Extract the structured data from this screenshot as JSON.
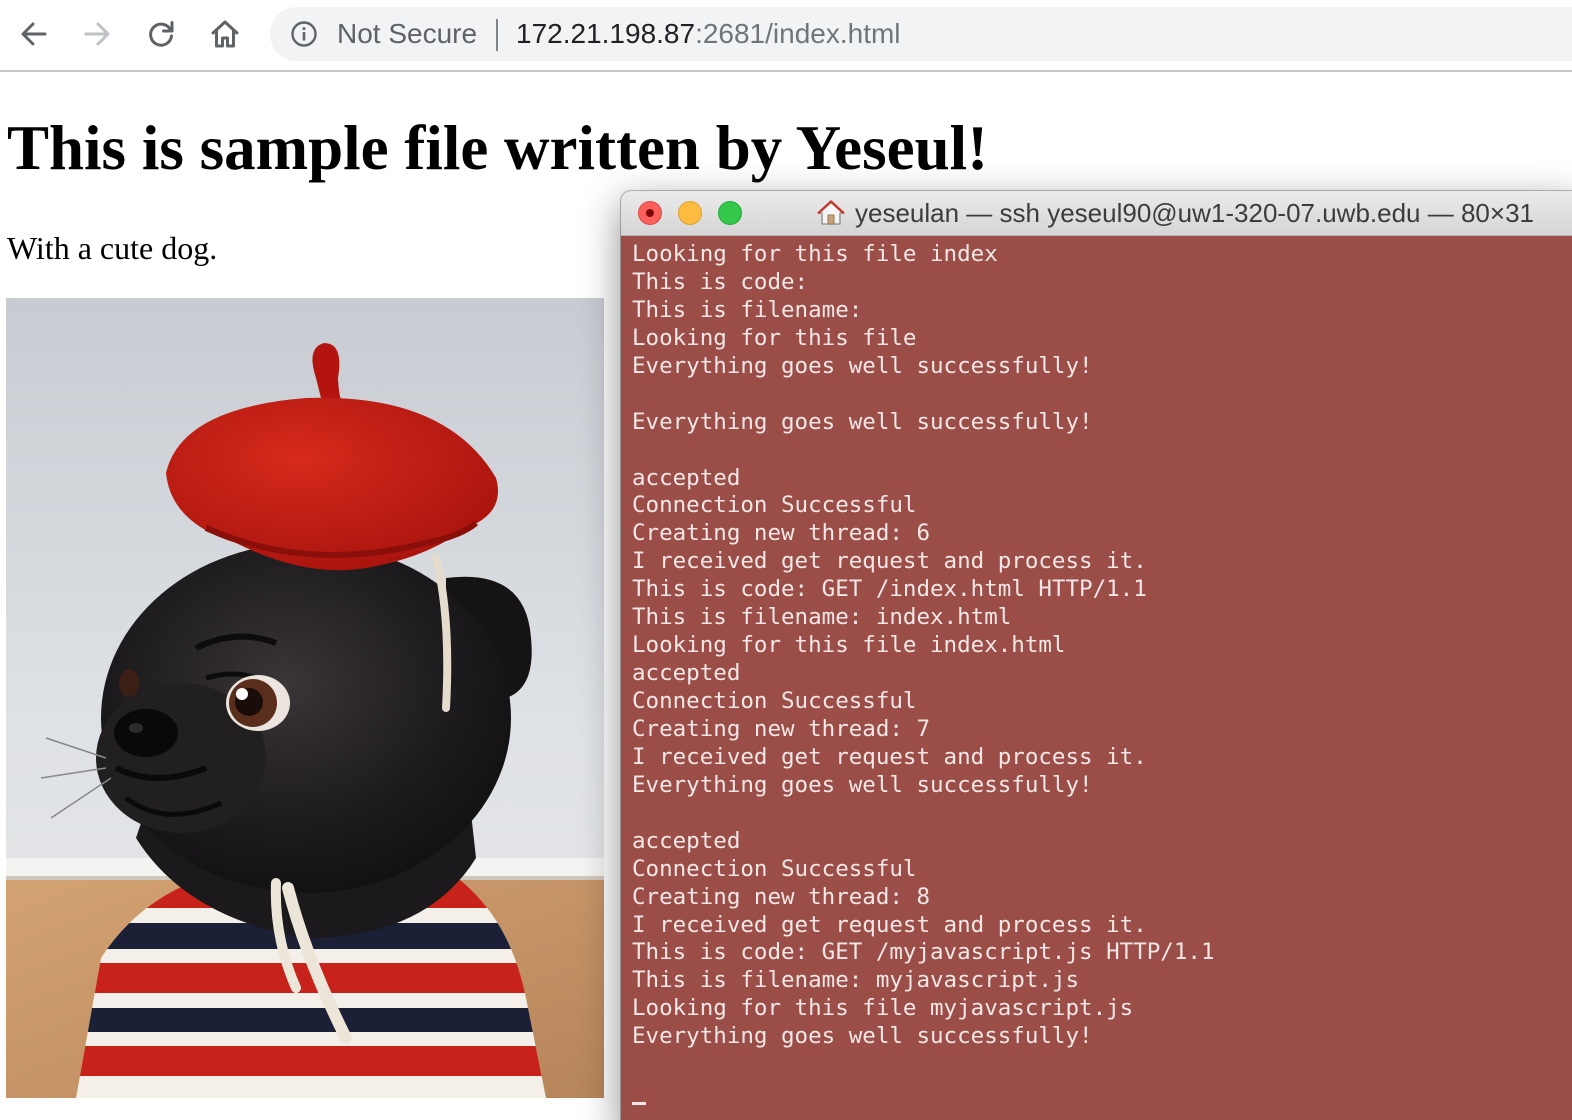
{
  "browser": {
    "security_label": "Not Secure",
    "url_host": "172.21.198.87",
    "url_rest": ":2681/index.html",
    "icons": {
      "back": "arrow-left-icon",
      "forward": "arrow-right-icon",
      "reload": "reload-icon",
      "home": "home-icon",
      "info": "info-circle-icon"
    }
  },
  "page": {
    "heading": "This is sample file written by Yeseul!",
    "paragraph": "With a cute dog.",
    "image_subject": "black pug wearing a red beret and striped sweater"
  },
  "terminal": {
    "title": "yeseulan — ssh yeseul90@uw1-320-07.uwb.edu — 80×31",
    "background_color": "#9b4e47",
    "lines": [
      "Looking for this file index",
      "This is code:",
      "This is filename:",
      "Looking for this file",
      "Everything goes well successfully!",
      "",
      "Everything goes well successfully!",
      "",
      "accepted",
      "Connection Successful",
      "Creating new thread: 6",
      "I received get request and process it.",
      "This is code: GET /index.html HTTP/1.1",
      "This is filename: index.html",
      "Looking for this file index.html",
      "accepted",
      "Connection Successful",
      "Creating new thread: 7",
      "I received get request and process it.",
      "Everything goes well successfully!",
      "",
      "accepted",
      "Connection Successful",
      "Creating new thread: 8",
      "I received get request and process it.",
      "This is code: GET /myjavascript.js HTTP/1.1",
      "This is filename: myjavascript.js",
      "Looking for this file myjavascript.js",
      "Everything goes well successfully!"
    ]
  }
}
